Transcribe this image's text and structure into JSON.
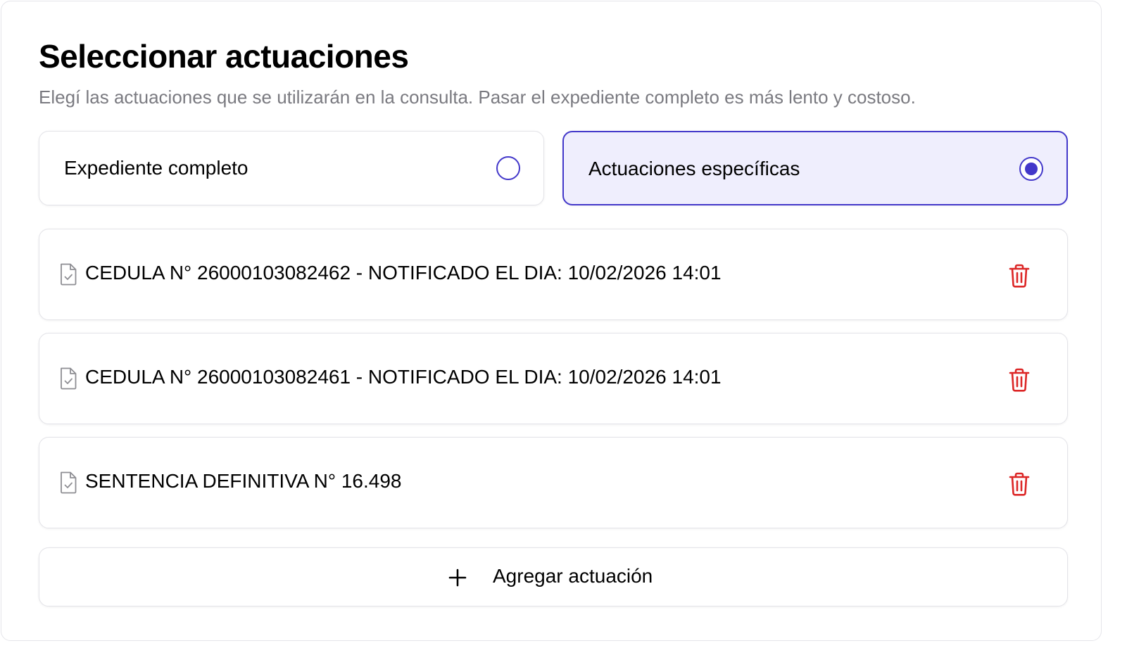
{
  "header": {
    "title": "Seleccionar actuaciones",
    "subtitle": "Elegí las actuaciones que se utilizarán en la consulta. Pasar el expediente completo es más lento y costoso."
  },
  "options": [
    {
      "label": "Expediente completo",
      "selected": false
    },
    {
      "label": "Actuaciones específicas",
      "selected": true
    }
  ],
  "items": [
    {
      "label": "CEDULA N° 26000103082462 - NOTIFICADO EL DIA: 10/02/2026 14:01",
      "icon": "document-check-icon"
    },
    {
      "label": "CEDULA N° 26000103082461 - NOTIFICADO EL DIA: 10/02/2026 14:01",
      "icon": "document-check-icon"
    },
    {
      "label": "SENTENCIA DEFINITIVA N° 16.498",
      "icon": "document-check-icon"
    }
  ],
  "add_button": {
    "label": "Agregar actuación",
    "icon": "plus-icon"
  },
  "colors": {
    "accent": "#4338ca",
    "selected_bg": "#efeefd",
    "delete": "#dc2626",
    "muted_text": "#7a7a80",
    "border": "#e3e3e8"
  }
}
